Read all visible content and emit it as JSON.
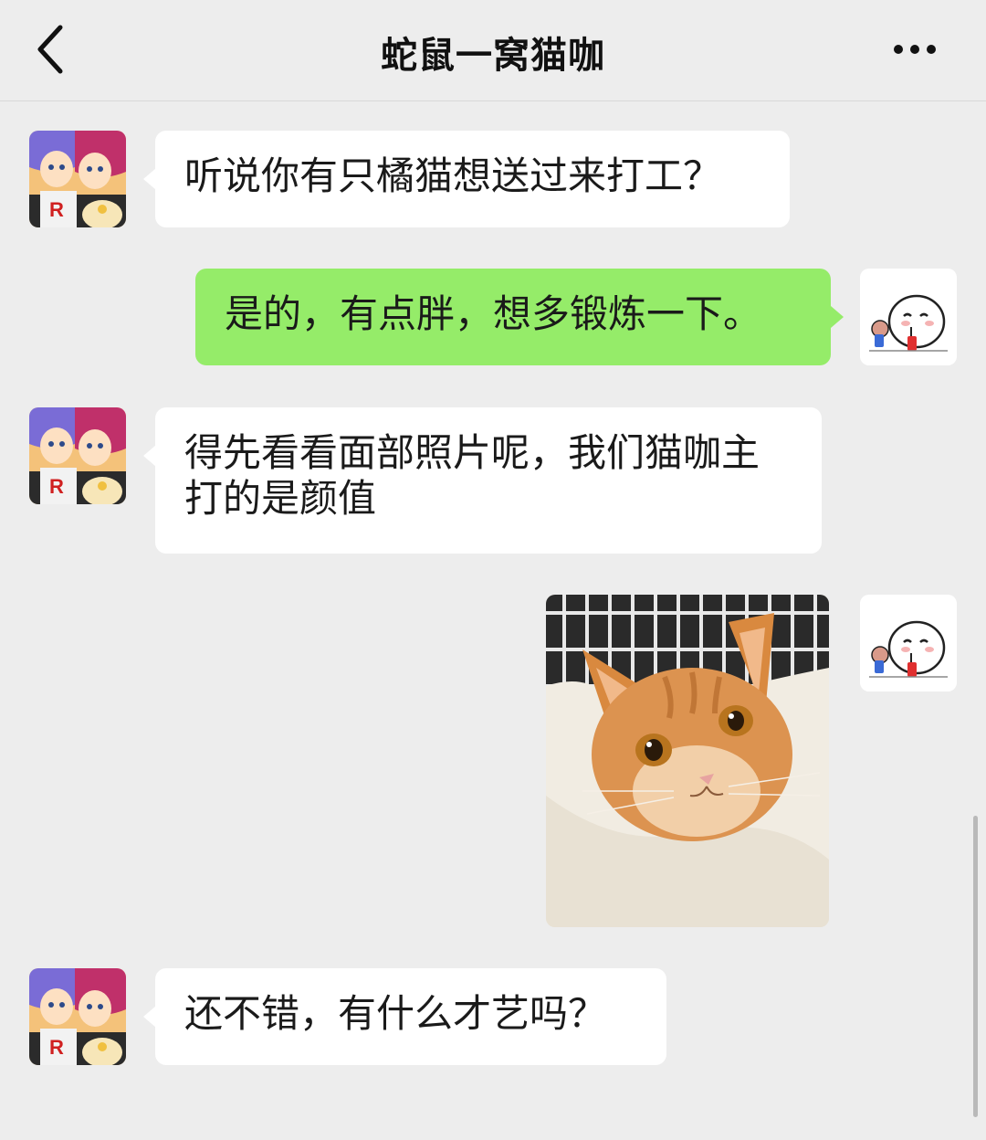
{
  "header": {
    "title": "蛇鼠一窝猫咖",
    "back_icon": "chevron-left-icon",
    "more_icon": "more-dots-icon"
  },
  "messages": [
    {
      "side": "left",
      "type": "text",
      "text": "听说你有只橘猫想送过来打工？"
    },
    {
      "side": "right",
      "type": "text",
      "text": "是的，有点胖，想多锻炼一下。"
    },
    {
      "side": "left",
      "type": "text",
      "text": "得先看看面部照片呢，我们猫咖主打的是颜值"
    },
    {
      "side": "right",
      "type": "image",
      "image_desc": "orange-cat-photo"
    },
    {
      "side": "left",
      "type": "text",
      "text": "还不错，有什么才艺吗？"
    }
  ],
  "colors": {
    "background": "#ededed",
    "self_bubble": "#95ec69",
    "other_bubble": "#ffffff"
  }
}
